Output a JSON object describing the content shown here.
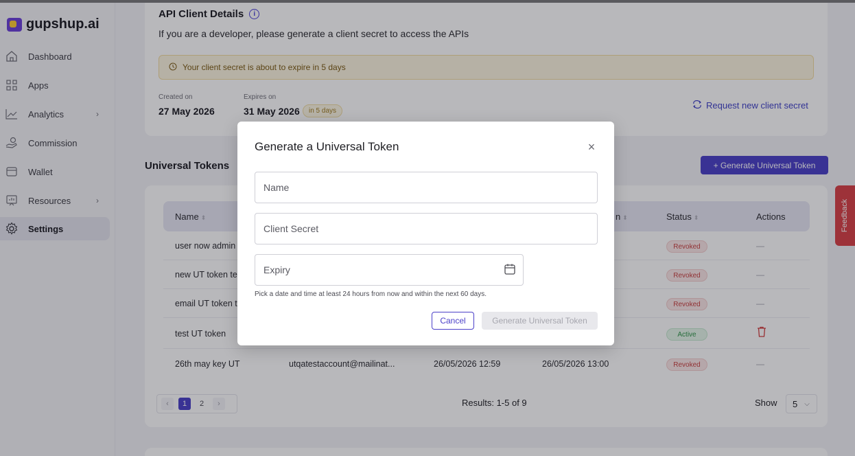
{
  "brand": {
    "name": "gupshup.ai"
  },
  "sidebar": {
    "items": [
      {
        "label": "Dashboard",
        "icon": "home-icon"
      },
      {
        "label": "Apps",
        "icon": "grid-icon"
      },
      {
        "label": "Analytics",
        "icon": "chart-icon",
        "has_submenu": true
      },
      {
        "label": "Commission",
        "icon": "hand-coin-icon"
      },
      {
        "label": "Wallet",
        "icon": "wallet-icon"
      },
      {
        "label": "Resources",
        "icon": "book-icon",
        "has_submenu": true
      },
      {
        "label": "Settings",
        "icon": "gear-icon",
        "active": true
      }
    ]
  },
  "details": {
    "title": "API Client Details",
    "subtitle": "If you are a developer, please generate a client secret to access the APIs",
    "warning": "Your client secret is about to expire in 5 days",
    "created_label": "Created on",
    "created_value": "27 May 2026",
    "expires_label": "Expires on",
    "expires_value": "31 May 2026",
    "expires_badge": "in 5 days",
    "request_link": "Request new client secret"
  },
  "tokens": {
    "title": "Universal Tokens",
    "generate_button": "+ Generate Universal Token",
    "columns": {
      "name": "Name",
      "expiry_partial": "n",
      "status": "Status",
      "actions": "Actions"
    },
    "rows": [
      {
        "name": "user now admin",
        "status": "Revoked"
      },
      {
        "name": "new UT token te",
        "status": "Revoked"
      },
      {
        "name": "email UT token t",
        "status": "Revoked"
      },
      {
        "name": "test UT token",
        "status": "Active"
      },
      {
        "name": "26th may key UT",
        "email": "utqatestaccount@mailinat...",
        "created": "26/05/2026 12:59",
        "expires": "26/05/2026 13:00",
        "status": "Revoked"
      }
    ],
    "pages": [
      "1",
      "2"
    ],
    "prev": "‹",
    "next": "›",
    "results": "Results: 1-5 of 9",
    "show_label": "Show",
    "show_value": "5"
  },
  "feedback": "Feedback",
  "modal": {
    "title": "Generate a Universal Token",
    "name_placeholder": "Name",
    "secret_placeholder": "Client Secret",
    "expiry_placeholder": "Expiry",
    "hint": "Pick a date and time at least 24 hours from now and within the next 60 days.",
    "cancel": "Cancel",
    "generate": "Generate Universal Token"
  },
  "colors": {
    "accent": "#4a3fc8",
    "warning_bg": "#fdf5e0",
    "revoked": "#c84040",
    "active": "#2e9448",
    "feedback": "#d94046"
  }
}
